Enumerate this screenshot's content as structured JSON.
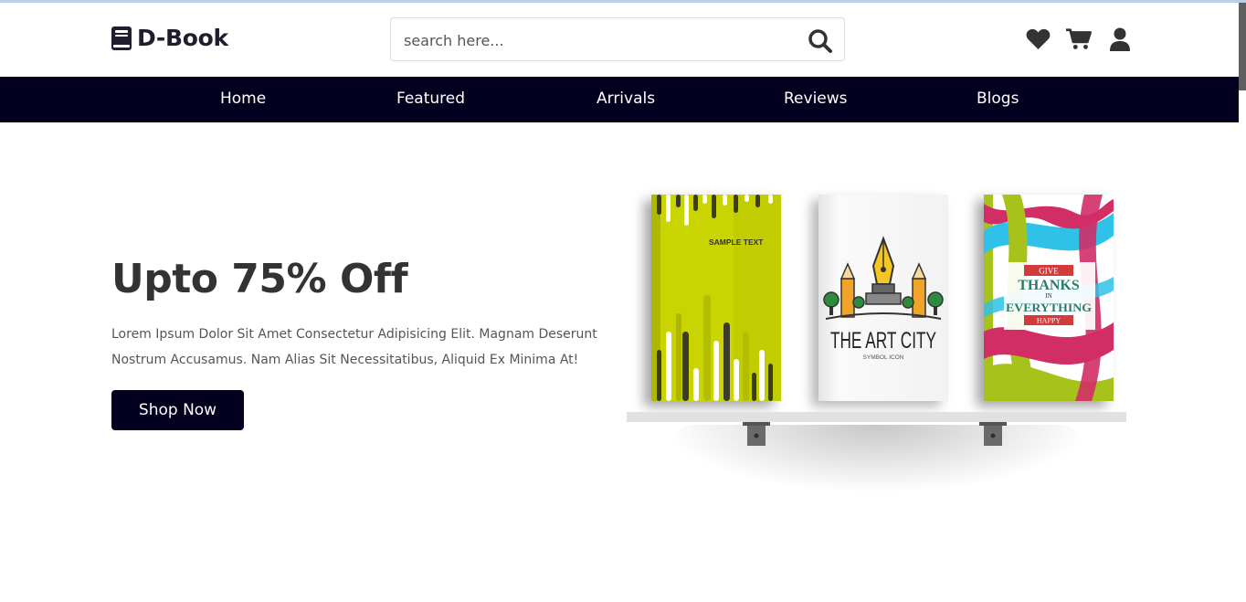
{
  "brand": {
    "name": "D-Book",
    "logo_icon": "book-icon"
  },
  "search": {
    "placeholder": "search here...",
    "icon": "search-icon"
  },
  "header_icons": [
    "heart-icon",
    "cart-icon",
    "user-icon"
  ],
  "nav": {
    "items": [
      {
        "label": "Home"
      },
      {
        "label": "Featured"
      },
      {
        "label": "Arrivals"
      },
      {
        "label": "Reviews"
      },
      {
        "label": "Blogs"
      }
    ]
  },
  "hero": {
    "title": "Upto 75% Off",
    "description": "Lorem Ipsum Dolor Sit Amet Consectetur Adipisicing Elit. Magnam Deserunt Nostrum Accusamus. Nam Alias Sit Necessitatibus, Aliquid Ex Minima At!",
    "button_label": "Shop Now"
  },
  "books": [
    {
      "cover_text": "SAMPLE TEXT"
    },
    {
      "cover_title": "THE ART CITY",
      "cover_subtitle": "SYMBOL ICON"
    },
    {
      "cover_line1": "GIVE",
      "cover_line2": "THANKS",
      "cover_line3": "IN",
      "cover_line4": "EVERYTHING",
      "cover_line5": "HAPPY"
    }
  ],
  "colors": {
    "dark": "#02001e",
    "accent_lime": "#c7d400",
    "text": "#333333"
  }
}
